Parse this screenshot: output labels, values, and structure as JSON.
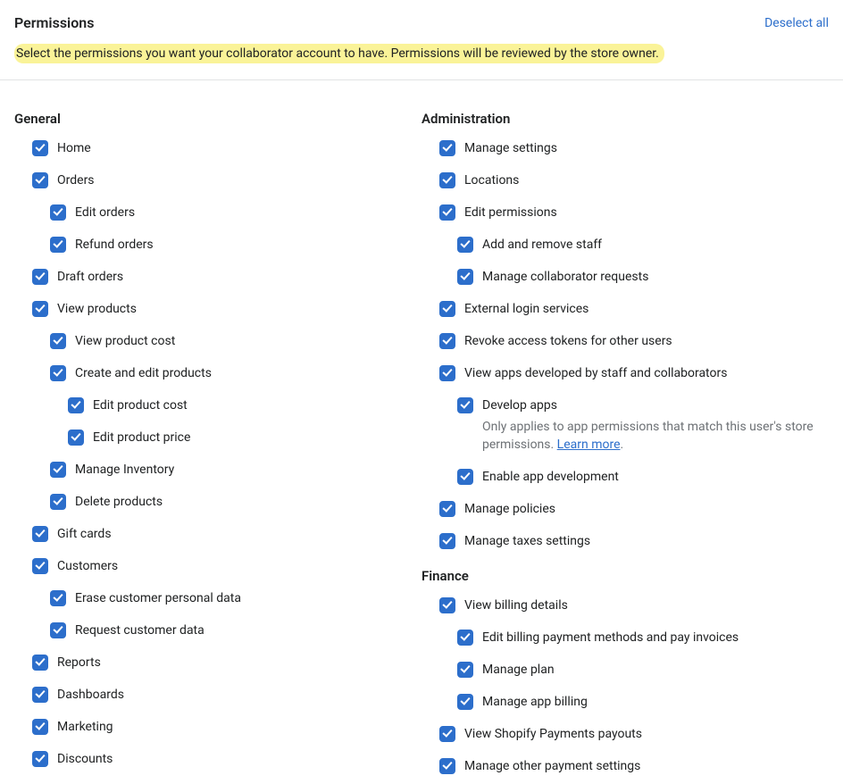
{
  "header": {
    "title": "Permissions",
    "deselect": "Deselect all"
  },
  "note": "Select the permissions you want your collaborator account to have. Permissions will be reviewed by the store owner.",
  "sections": {
    "general": {
      "title": "General",
      "home": "Home",
      "orders": "Orders",
      "edit_orders": "Edit orders",
      "refund_orders": "Refund orders",
      "draft_orders": "Draft orders",
      "view_products": "View products",
      "view_product_cost": "View product cost",
      "create_edit_products": "Create and edit products",
      "edit_product_cost": "Edit product cost",
      "edit_product_price": "Edit product price",
      "manage_inventory": "Manage Inventory",
      "delete_products": "Delete products",
      "gift_cards": "Gift cards",
      "customers": "Customers",
      "erase_customer_data": "Erase customer personal data",
      "request_customer_data": "Request customer data",
      "reports": "Reports",
      "dashboards": "Dashboards",
      "marketing": "Marketing",
      "discounts": "Discounts"
    },
    "administration": {
      "title": "Administration",
      "manage_settings": "Manage settings",
      "locations": "Locations",
      "edit_permissions": "Edit permissions",
      "add_remove_staff": "Add and remove staff",
      "manage_collab_requests": "Manage collaborator requests",
      "external_login": "External login services",
      "revoke_tokens": "Revoke access tokens for other users",
      "view_apps_dev": "View apps developed by staff and collaborators",
      "develop_apps": "Develop apps",
      "develop_apps_sub": "Only applies to app permissions that match this user's store permissions. ",
      "learn_more": "Learn more",
      "enable_app_dev": "Enable app development",
      "manage_policies": "Manage policies",
      "manage_taxes": "Manage taxes settings"
    },
    "finance": {
      "title": "Finance",
      "view_billing": "View billing details",
      "edit_billing_methods": "Edit billing payment methods and pay invoices",
      "manage_plan": "Manage plan",
      "manage_app_billing": "Manage app billing",
      "view_payouts": "View Shopify Payments payouts",
      "manage_other_payment": "Manage other payment settings"
    }
  }
}
